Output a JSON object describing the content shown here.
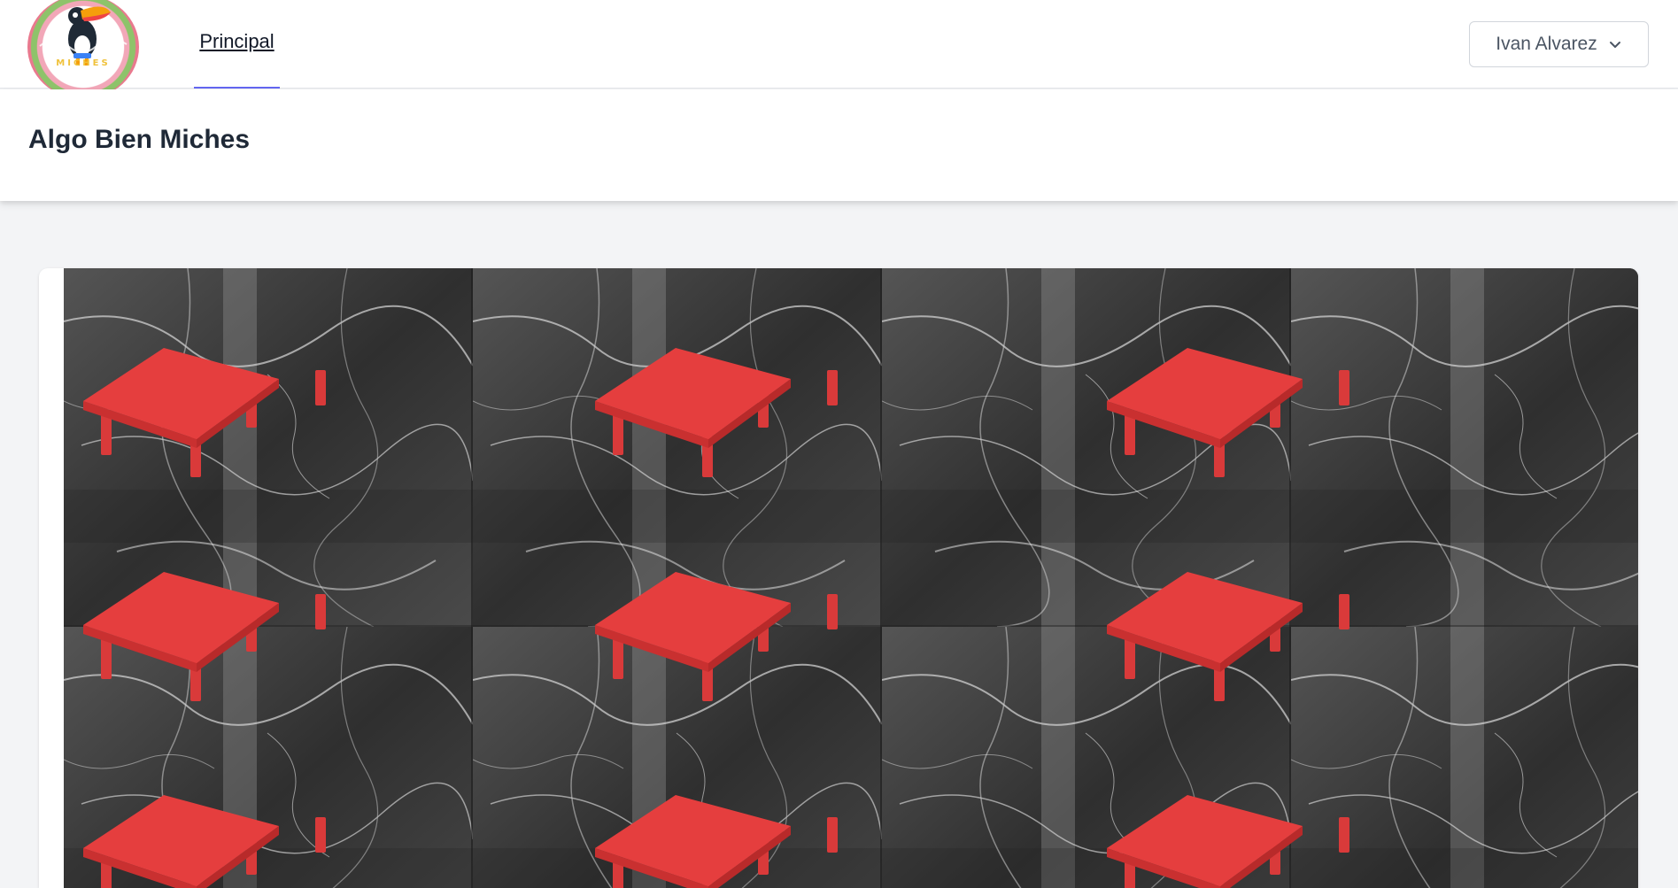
{
  "nav": {
    "logo_text": "MICHES",
    "links": [
      {
        "label": "Principal",
        "active": true
      }
    ],
    "user_menu": {
      "label": "Ivan Alvarez",
      "icon": "chevron-down-icon"
    }
  },
  "header": {
    "title": "Algo Bien Miches"
  },
  "floor_plan": {
    "background": "gray marble texture",
    "table_color": "#e53e3e",
    "tables": [
      {
        "row": 1,
        "col": 1
      },
      {
        "row": 1,
        "col": 2
      },
      {
        "row": 1,
        "col": 3
      },
      {
        "row": 2,
        "col": 1
      },
      {
        "row": 2,
        "col": 2
      },
      {
        "row": 2,
        "col": 3
      },
      {
        "row": 3,
        "col": 1
      },
      {
        "row": 3,
        "col": 2
      },
      {
        "row": 3,
        "col": 3
      }
    ]
  },
  "colors": {
    "accent": "#6366f1",
    "page_bg": "#f3f4f6",
    "table": "#e53e3e"
  }
}
